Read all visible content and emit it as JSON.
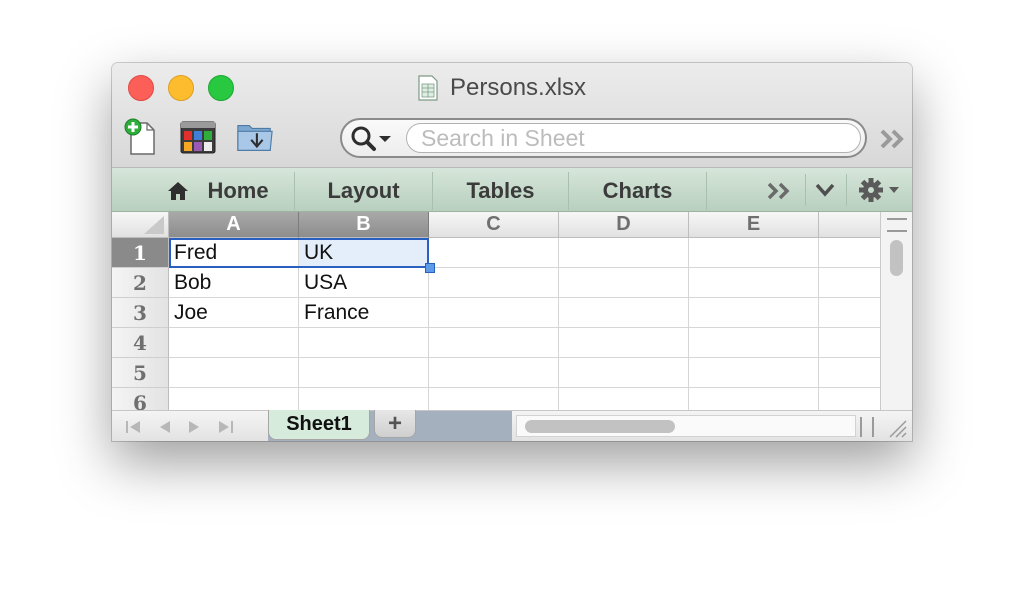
{
  "window": {
    "title": "Persons.xlsx"
  },
  "toolbar": {
    "new_icon": "new-document-icon",
    "gallery_icon": "gallery-icon",
    "open_icon": "open-folder-icon",
    "search_placeholder": "Search in Sheet",
    "more_icon": "double-chevron-icon"
  },
  "ribbon": {
    "tabs": [
      {
        "label": "Home",
        "icon": "home-icon"
      },
      {
        "label": "Layout"
      },
      {
        "label": "Tables"
      },
      {
        "label": "Charts"
      }
    ],
    "overflow_icon": "double-chevron-icon",
    "collapse_icon": "chevron-down-icon",
    "settings_icon": "gear-icon"
  },
  "sheet": {
    "columns": [
      "A",
      "B",
      "C",
      "D",
      "E"
    ],
    "rows": [
      "1",
      "2",
      "3",
      "4",
      "5",
      "6"
    ],
    "cells": [
      [
        "Fred",
        "UK",
        "",
        "",
        ""
      ],
      [
        "Bob",
        "USA",
        "",
        "",
        ""
      ],
      [
        "Joe",
        "France",
        "",
        "",
        ""
      ],
      [
        "",
        "",
        "",
        "",
        ""
      ],
      [
        "",
        "",
        "",
        "",
        ""
      ],
      [
        "",
        "",
        "",
        "",
        ""
      ]
    ],
    "selected_range": "A1:B1"
  },
  "bottom": {
    "sheet_tabs": [
      "Sheet1"
    ],
    "add_sheet_label": "+"
  },
  "colors": {
    "ribbon": "#c8dccd",
    "selection_border": "#2a5fc2",
    "selected_header": "#8a8a8a",
    "sheet_tab": "#d7ebdc"
  }
}
